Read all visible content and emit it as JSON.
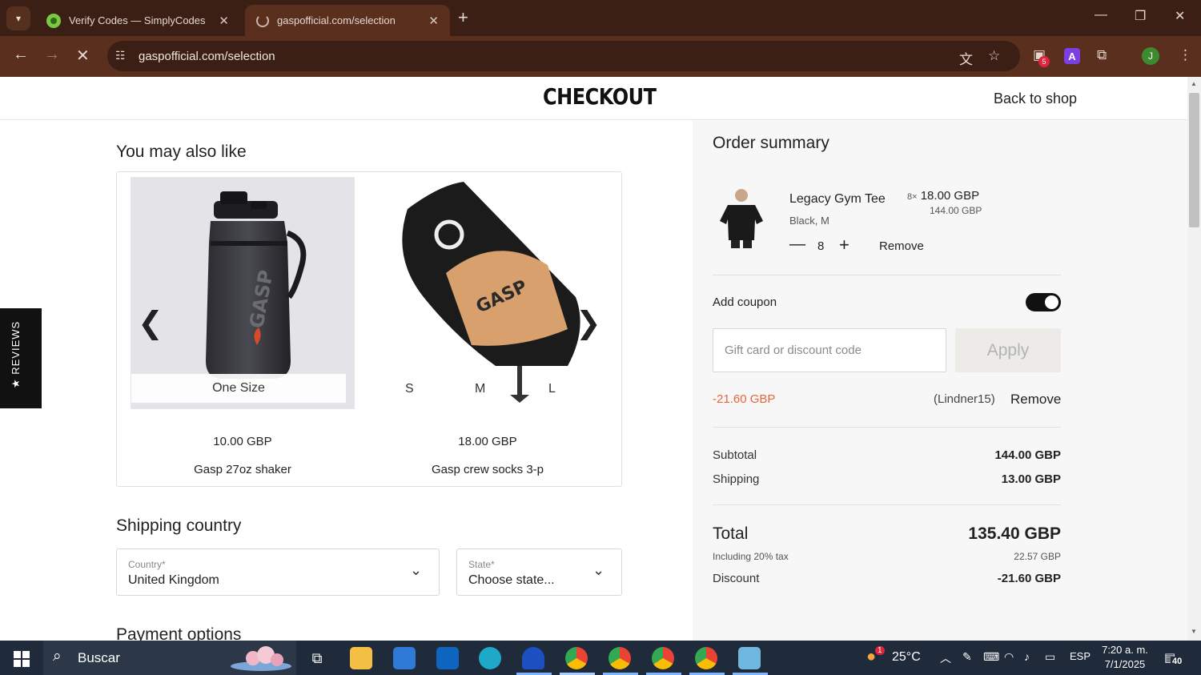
{
  "browser": {
    "tabs": [
      {
        "title": "Verify Codes — SimplyCodes"
      },
      {
        "title": "gaspofficial.com/selection"
      }
    ],
    "url": "gaspofficial.com/selection",
    "extension_badge": "5",
    "profile_initial": "J"
  },
  "header": {
    "logo": "CHECKOUT",
    "back_link": "Back to shop"
  },
  "reviews_tab": "★ REVIEWS",
  "recommendations": {
    "title": "You may also like",
    "items": [
      {
        "name": "Gasp 27oz shaker",
        "price": "10.00 GBP",
        "sizes": [
          "One Size"
        ]
      },
      {
        "name": "Gasp crew socks 3-p",
        "price": "18.00 GBP",
        "sizes": [
          "S",
          "M",
          "L"
        ]
      }
    ]
  },
  "shipping": {
    "title": "Shipping country",
    "country_label": "Country*",
    "country_value": "United Kingdom",
    "state_label": "State*",
    "state_value": "Choose state..."
  },
  "payment": {
    "title": "Payment options"
  },
  "order_summary": {
    "title": "Order summary",
    "item": {
      "name": "Legacy Gym Tee",
      "variant": "Black,  M",
      "qty_prefix": "8×",
      "unit_price": "18.00 GBP",
      "line_total": "144.00 GBP",
      "qty": "8",
      "remove": "Remove"
    },
    "coupon": {
      "label": "Add coupon",
      "placeholder": "Gift card or discount code",
      "value": "",
      "apply": "Apply",
      "applied_amount": "-21.60 GBP",
      "applied_code": "(Lindner15)",
      "remove": "Remove"
    },
    "subtotal_label": "Subtotal",
    "subtotal": "144.00 GBP",
    "shipping_label": "Shipping",
    "shipping": "13.00 GBP",
    "total_label": "Total",
    "total": "135.40 GBP",
    "tax_label": "Including 20% tax",
    "tax": "22.57 GBP",
    "discount_label": "Discount",
    "discount": "-21.60 GBP"
  },
  "taskbar": {
    "search": "Buscar",
    "weather_temp": "25°C",
    "weather_alert": "1",
    "language": "ESP",
    "time": "7:20 a. m.",
    "date": "7/1/2025",
    "notifications": "40"
  },
  "colors": {
    "chrome_dark": "#3b1f14",
    "chrome_toolbar": "#5a2f1e",
    "discount_orange": "#e8643c",
    "summary_bg": "#f7f7f7"
  }
}
